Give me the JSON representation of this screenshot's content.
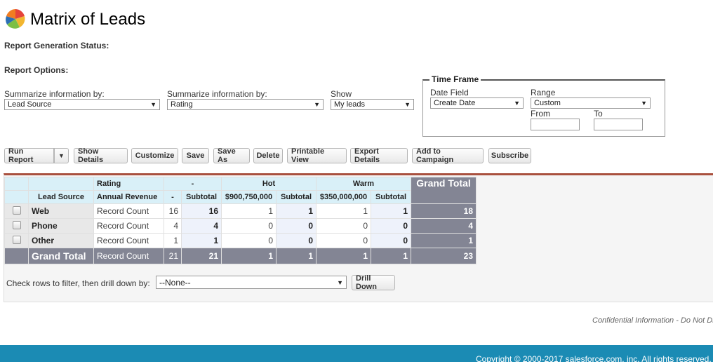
{
  "header": {
    "title": "Matrix of Leads"
  },
  "status_label": "Report Generation Status:",
  "options_label": "Report Options:",
  "options": {
    "summarize1": {
      "label": "Summarize information by:",
      "value": "Lead Source"
    },
    "summarize2": {
      "label": "Summarize information by:",
      "value": "Rating"
    },
    "show": {
      "label": "Show",
      "value": "My leads"
    }
  },
  "time_frame": {
    "legend": "Time Frame",
    "date_field_label": "Date Field",
    "date_field": "Create Date",
    "range_label": "Range",
    "range": "Custom",
    "from_label": "From",
    "to_label": "To",
    "from": "",
    "to": ""
  },
  "toolbar": {
    "run_report": "Run Report",
    "show_details": "Show Details",
    "customize": "Customize",
    "save": "Save",
    "save_as": "Save As",
    "delete": "Delete",
    "printable_view": "Printable View",
    "export_details": "Export Details",
    "add_to_campaign": "Add to Campaign",
    "subscribe": "Subscribe"
  },
  "matrix": {
    "rating_label": "Rating",
    "lead_source_label": "Lead Source",
    "annual_revenue_label": "Annual Revenue",
    "groups": [
      "-",
      "Hot",
      "Warm"
    ],
    "subheaders": [
      "-",
      "Subtotal",
      "$900,750,000",
      "Subtotal",
      "$350,000,000",
      "Subtotal"
    ],
    "grand_total_label": "Grand Total",
    "rows": [
      {
        "source": "Web",
        "measure": "Record Count",
        "values": [
          "16",
          "16",
          "1",
          "1",
          "1",
          "1"
        ],
        "total": "18"
      },
      {
        "source": "Phone",
        "measure": "Record Count",
        "values": [
          "4",
          "4",
          "0",
          "0",
          "0",
          "0"
        ],
        "total": "4"
      },
      {
        "source": "Other",
        "measure": "Record Count",
        "values": [
          "1",
          "1",
          "0",
          "0",
          "0",
          "0"
        ],
        "total": "1"
      }
    ],
    "grand_row": {
      "label": "Grand Total",
      "measure": "Record Count",
      "values": [
        "21",
        "21",
        "1",
        "1",
        "1",
        "1"
      ],
      "total": "23"
    }
  },
  "drill": {
    "label": "Check rows to filter, then drill down by:",
    "value": "--None--",
    "button": "Drill Down"
  },
  "confidential": "Confidential Information - Do Not Distribute",
  "copyright": "Copyright © 2000-2017 salesforce.com, inc. All rights reserved."
}
